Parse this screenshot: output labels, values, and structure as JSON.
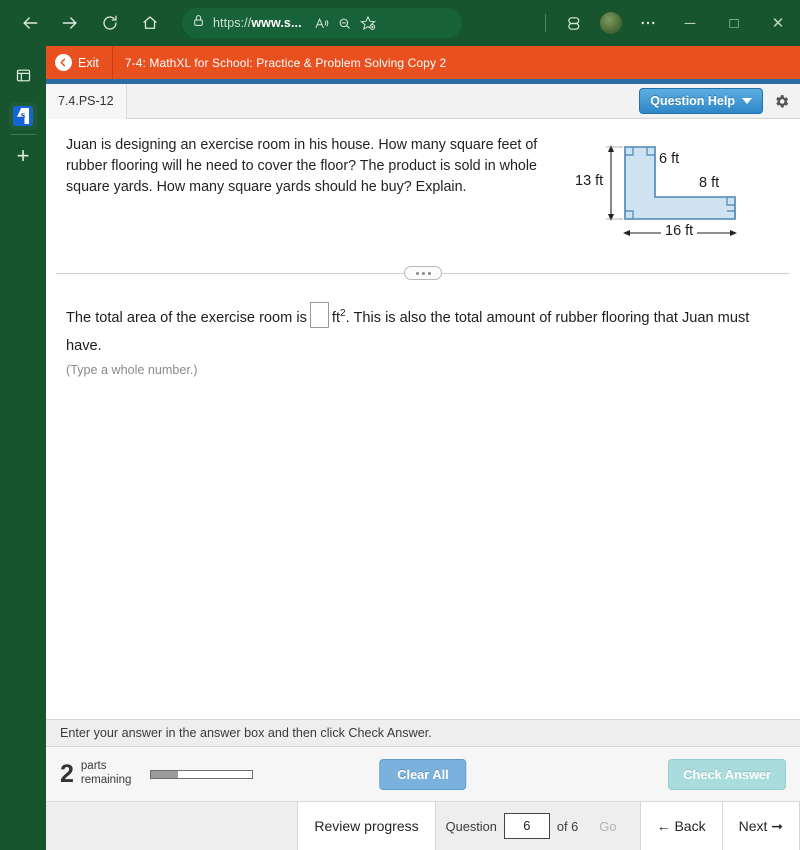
{
  "browser": {
    "back_icon": "back-arrow-icon",
    "forward_icon": "forward-arrow-icon",
    "refresh_icon": "refresh-icon",
    "home_icon": "home-icon",
    "lock_icon": "lock-icon",
    "url_prefix": "https://",
    "url_bold": "www.s...",
    "read_aloud_icon": "read-aloud-icon",
    "zoom_icon": "zoom-out-icon",
    "favorite_icon": "add-favorite-icon",
    "collections_icon": "browser-essentials-icon",
    "more_icon": "more-options-icon",
    "minimize": "─",
    "maximize": "□",
    "close": "✕"
  },
  "sidebar": {
    "tab_icon": "tab-panel-icon",
    "app_icon_letter": "s",
    "add_label": "+"
  },
  "mathxl": {
    "exit_label": "Exit",
    "assignment_title": "7-4: MathXL for School: Practice & Problem Solving Copy 2",
    "accent_orange": "#e8501f"
  },
  "exercise": {
    "exercise_id": "7.4.PS-12",
    "question_help_label": "Question Help",
    "gear_icon": "settings-gear-icon"
  },
  "question": {
    "text": "Juan is designing an exercise room in his house. How many square feet of rubber flooring will he need to cover the floor? The product is sold in whole square yards. How many square yards should he buy? Explain."
  },
  "figure": {
    "shape": "L-shaped room",
    "fill_color": "#cfe2f0",
    "stroke_color": "#4a86b8",
    "labels": {
      "left_height": "13 ft",
      "inner_vertical": "6 ft",
      "inner_horizontal": "8 ft",
      "bottom_width": "16 ft"
    }
  },
  "answer": {
    "line_part1": "The total area of the exercise room is",
    "input_value": "",
    "unit": "ft",
    "unit_exponent": "2",
    "line_part2": ". This is also the total amount of rubber flooring that Juan must have.",
    "hint": "(Type a whole number.)"
  },
  "footer": {
    "instruction": "Enter your answer in the answer box and then click Check Answer.",
    "parts_count": "2",
    "parts_label_line1": "parts",
    "parts_label_line2": "remaining",
    "progress_percent": 26,
    "clear_all_label": "Clear All",
    "check_answer_label": "Check Answer"
  },
  "navigation": {
    "review_progress_label": "Review progress",
    "question_word": "Question",
    "question_number": "6",
    "of_label": "of 6",
    "go_label": "Go",
    "back_label": "Back",
    "next_label": "Next"
  }
}
